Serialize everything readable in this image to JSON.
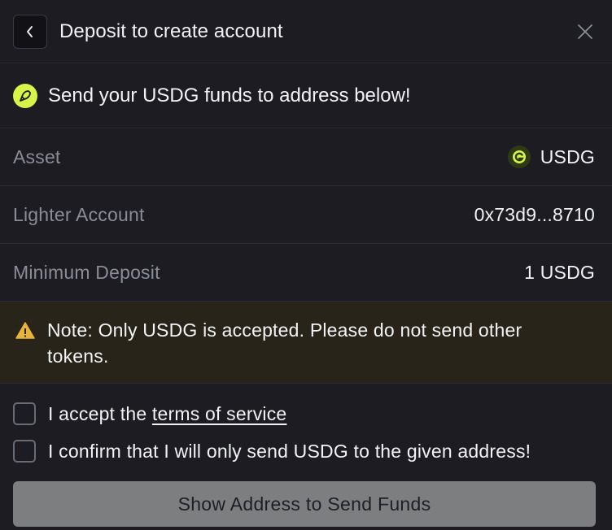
{
  "header": {
    "title": "Deposit to create account",
    "back_icon": "chevron-left-icon",
    "close_icon": "close-icon"
  },
  "info": {
    "icon": "rocket-icon",
    "text": "Send your USDG funds to address below!"
  },
  "details": [
    {
      "label": "Asset",
      "value": "USDG",
      "icon": "usdg-coin-icon"
    },
    {
      "label": "Lighter Account",
      "value": "0x73d9...8710"
    },
    {
      "label": "Minimum Deposit",
      "value": "1 USDG"
    }
  ],
  "note": {
    "icon": "warning-icon",
    "text": "Note: Only USDG is accepted. Please do not send other tokens."
  },
  "checks": {
    "terms_prefix": "I accept the ",
    "terms_link": "terms of service",
    "confirm_text": "I confirm that I will only send USDG to the given address!"
  },
  "cta": {
    "label": "Show Address to Send Funds"
  },
  "colors": {
    "background": "#1c1c22",
    "accent": "#d6f548",
    "note_bg": "#29241a",
    "warning": "#e6b43c",
    "button_disabled": "#7d7e80"
  }
}
